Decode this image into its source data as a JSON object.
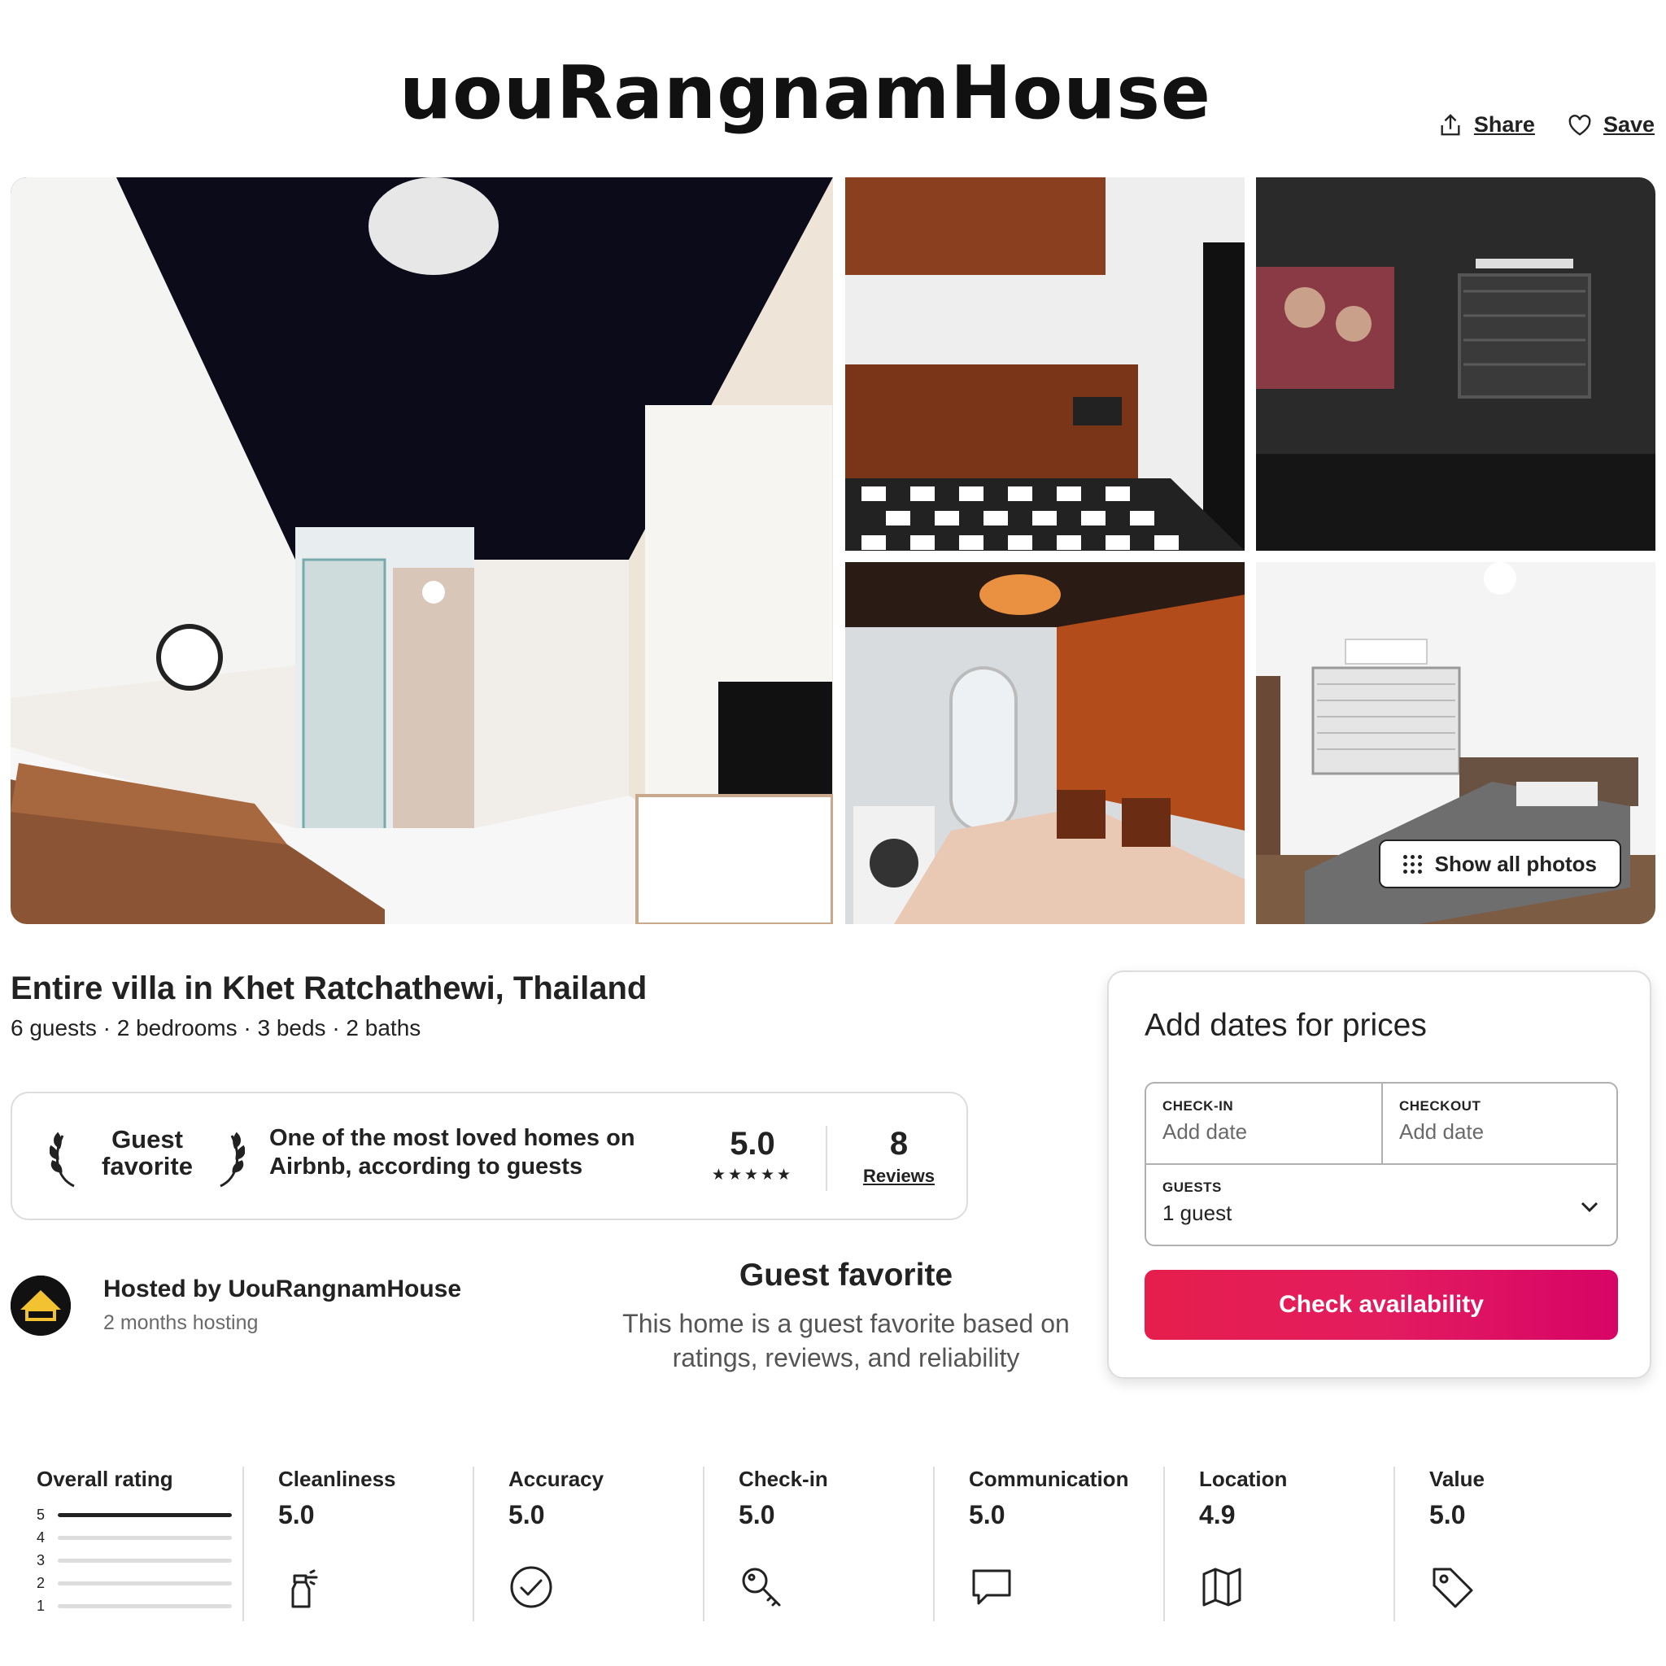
{
  "header": {
    "title": "uouRangnamHouse",
    "share_label": "Share",
    "save_label": "Save"
  },
  "gallery": {
    "show_all_label": "Show all photos"
  },
  "listing": {
    "title": "Entire villa in Khet Ratchathewi, Thailand",
    "details": "6 guests · 2 bedrooms · 3 beds · 2 baths"
  },
  "guest_favorite_card": {
    "badge_line1": "Guest",
    "badge_line2": "favorite",
    "description_line1": "One of the most loved homes on",
    "description_line2": "Airbnb, according to guests",
    "rating": "5.0",
    "stars": "★★★★★",
    "reviews_count": "8",
    "reviews_label": "Reviews"
  },
  "host": {
    "name": "Hosted by UouRangnamHouse",
    "meta": "2 months hosting"
  },
  "guest_favorite_section": {
    "title": "Guest favorite",
    "description_line1": "This home is a guest favorite based on",
    "description_line2": "ratings, reviews, and reliability"
  },
  "booking": {
    "title": "Add dates for prices",
    "checkin_label": "CHECK-IN",
    "checkin_value": "Add date",
    "checkout_label": "CHECKOUT",
    "checkout_value": "Add date",
    "guests_label": "GUESTS",
    "guests_value": "1 guest",
    "button_label": "Check availability",
    "button_color": "#e31c5f"
  },
  "ratings": {
    "overall_label": "Overall rating",
    "distribution": [
      {
        "level": "5",
        "fraction": 1.0
      },
      {
        "level": "4",
        "fraction": 0.0
      },
      {
        "level": "3",
        "fraction": 0.0
      },
      {
        "level": "2",
        "fraction": 0.0
      },
      {
        "level": "1",
        "fraction": 0.0
      }
    ],
    "categories": [
      {
        "label": "Cleanliness",
        "value": "5.0",
        "icon": "spray-bottle-icon"
      },
      {
        "label": "Accuracy",
        "value": "5.0",
        "icon": "check-circle-icon"
      },
      {
        "label": "Check-in",
        "value": "5.0",
        "icon": "key-icon"
      },
      {
        "label": "Communication",
        "value": "5.0",
        "icon": "message-icon"
      },
      {
        "label": "Location",
        "value": "4.9",
        "icon": "map-icon"
      },
      {
        "label": "Value",
        "value": "5.0",
        "icon": "tag-icon"
      }
    ]
  }
}
